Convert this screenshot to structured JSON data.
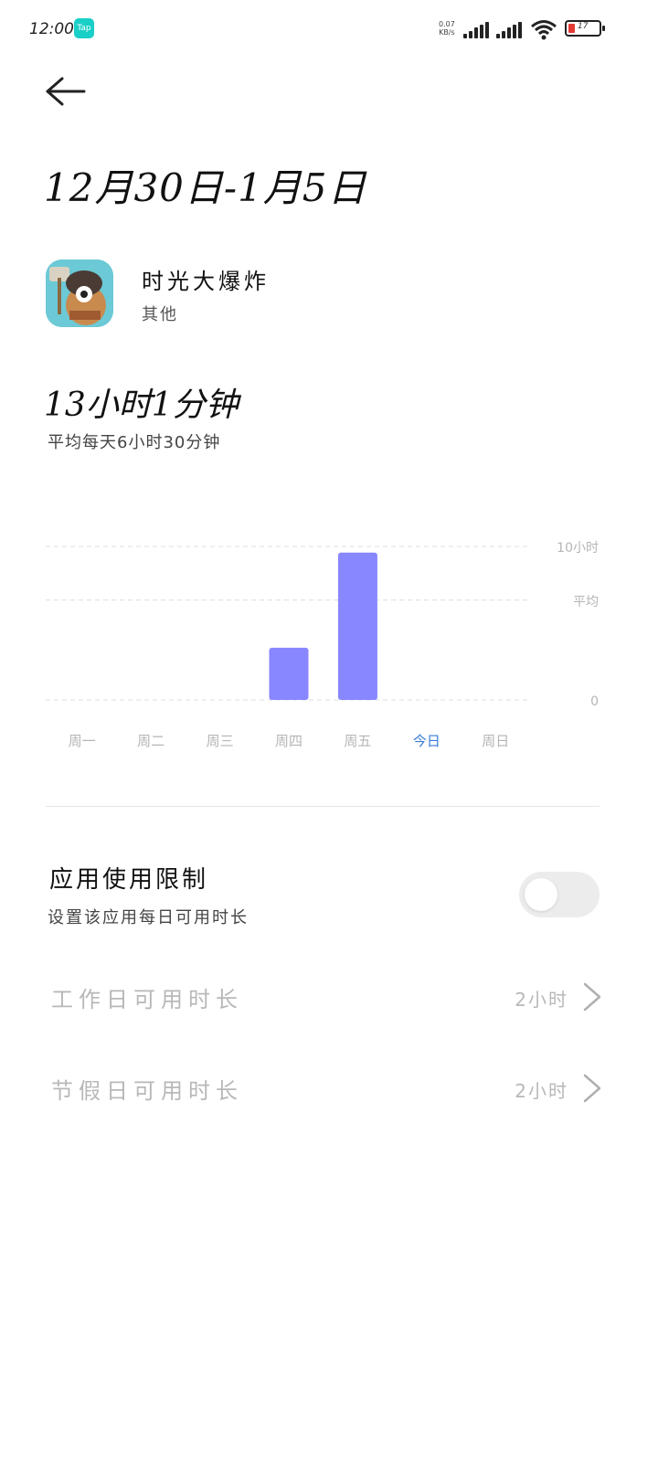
{
  "status_bar": {
    "time": "12:00",
    "net_speed": "0.07",
    "net_unit": "KB/s",
    "battery": "17",
    "colors": {
      "battery_low": "#e53935",
      "app_mini": "#19d0c8"
    },
    "icons": [
      "taptap-icon",
      "signal-icon",
      "signal-icon",
      "wifi-icon",
      "battery-icon"
    ]
  },
  "header": {
    "date_range": "12月30日-1月5日",
    "back_icon": "back-arrow-icon"
  },
  "app": {
    "name": "时光大爆炸",
    "category": "其他"
  },
  "summary": {
    "total": "13小时1分钟",
    "average": "平均每天6小时30分钟"
  },
  "chart_data": {
    "type": "bar",
    "categories": [
      "周一",
      "周二",
      "周三",
      "周四",
      "周五",
      "今日",
      "周日"
    ],
    "values": [
      0,
      0,
      0,
      3.4,
      9.6,
      0,
      0
    ],
    "average": 6.5,
    "ylim": [
      0,
      10
    ],
    "y_labels": {
      "max": "10小时",
      "avg": "平均",
      "zero": "0"
    },
    "highlight_category": "今日",
    "colors": {
      "bar": "#8887ff",
      "highlight_label": "#3a7bd5",
      "label": "#b5b5b5",
      "grid": "#dcdcdc"
    }
  },
  "limit": {
    "title": "应用使用限制",
    "subtitle": "设置该应用每日可用时长",
    "enabled": false
  },
  "rows": [
    {
      "label": "工作日可用时长",
      "value": "2小时"
    },
    {
      "label": "节假日可用时长",
      "value": "2小时"
    }
  ]
}
